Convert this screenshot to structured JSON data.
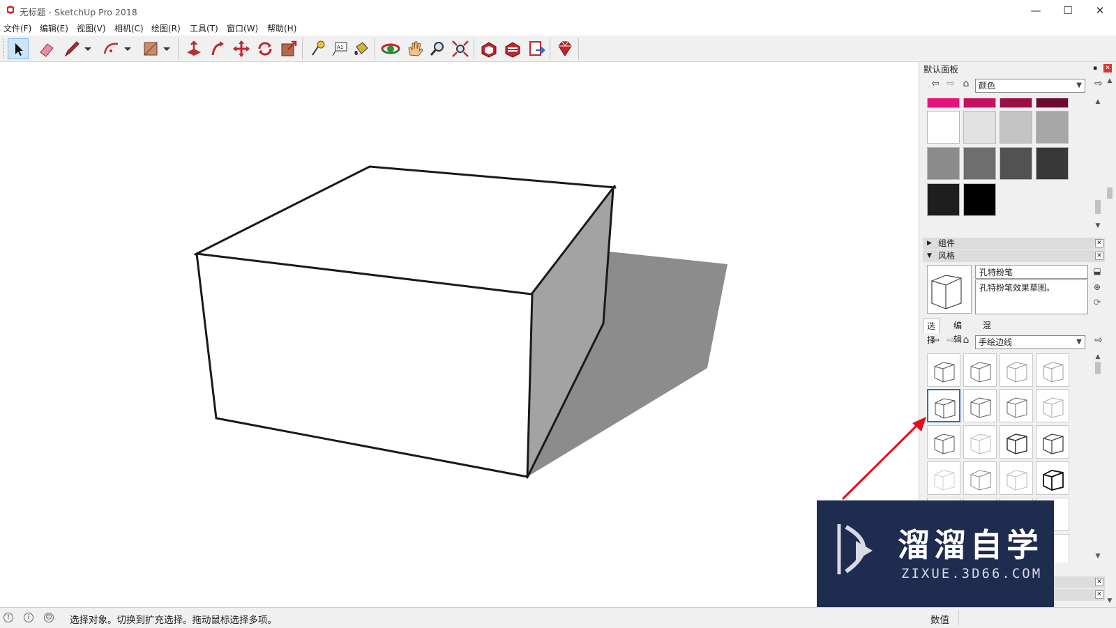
{
  "window": {
    "title": "无标题 - SketchUp Pro 2018",
    "controls": {
      "minimize": "—",
      "maximize": "☐",
      "close": "✕"
    }
  },
  "menu": [
    "文件(F)",
    "编辑(E)",
    "视图(V)",
    "相机(C)",
    "绘图(R)",
    "工具(T)",
    "窗口(W)",
    "帮助(H)"
  ],
  "toolbar": {
    "tools": [
      "select",
      "eraser",
      "line",
      "arc",
      "rectangle",
      "push-pull",
      "follow-me",
      "move",
      "rotate",
      "scale",
      "tape-measure",
      "text",
      "paint-bucket",
      "orbit",
      "pan",
      "zoom",
      "zoom-extents",
      "3d-warehouse",
      "extension-warehouse",
      "send-to-layout",
      "ruby-console"
    ],
    "active_tool": "select"
  },
  "tray": {
    "title": "默认面板",
    "materials": {
      "library": "颜色",
      "swatch_rows": [
        [
          "#e8127b",
          "#c4125f",
          "#9c0f45",
          "#6d0a2f"
        ],
        [
          "#ffffff",
          "#e2e2e2",
          "#c4c4c4",
          "#a6a6a6"
        ],
        [
          "#8b8b8b",
          "#6e6e6e",
          "#525252",
          "#383838"
        ],
        [
          "#1e1e1e",
          "#000000"
        ]
      ]
    },
    "components_label": "组件",
    "styles": {
      "label": "风格",
      "name": "孔特粉笔",
      "description": "孔特粉笔效果草图。",
      "tabs": [
        "选择",
        "编辑",
        "混合"
      ],
      "active_tab": "选择",
      "collection": "手绘边线",
      "selected_index": 4,
      "thumbnail_count": 24
    }
  },
  "status": {
    "message": "选择对象。切换到扩充选择。拖动鼠标选择多项。",
    "measurements_label": "数值",
    "measurements_value": ""
  },
  "watermark": {
    "brand": "溜溜自学",
    "url": "ZIXUE.3D66.COM"
  },
  "colors": {
    "accent": "#2f6fb5",
    "annotation_arrow": "#e0101a",
    "watermark_bg": "#1e2c4f",
    "shadow": "#8c8c8c",
    "box_side": "#a3a3a3"
  }
}
